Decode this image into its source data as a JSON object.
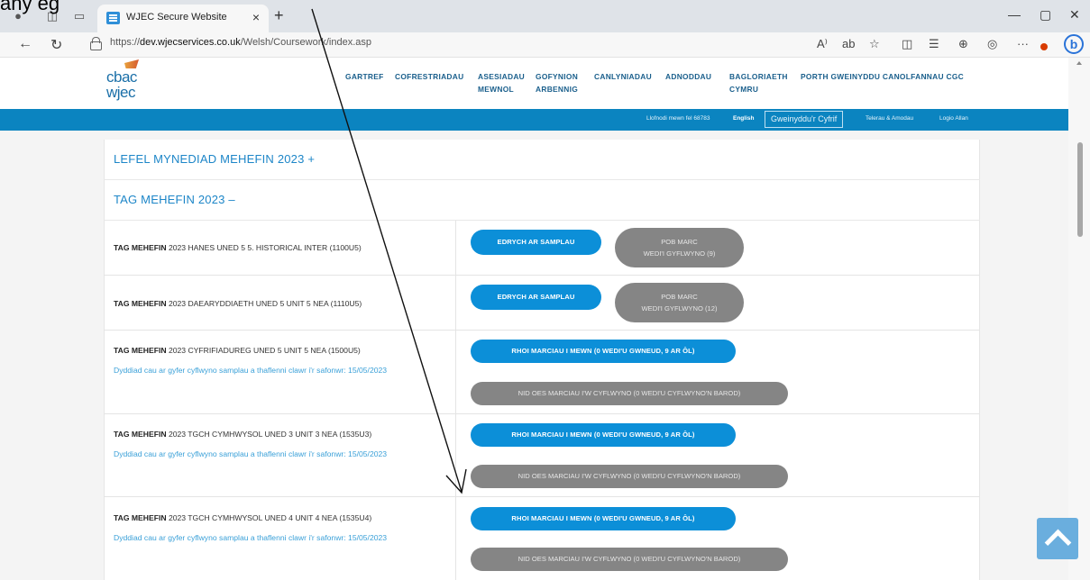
{
  "annotation_text": "any eg",
  "browser": {
    "tab_title": "WJEC Secure Website",
    "tab_close": "×",
    "new_tab": "+",
    "url_prefix": "https://",
    "url_domain": "dev.wjecservices.co.uk",
    "url_path": "/Welsh/Coursework/index.asp",
    "minimize": "—",
    "restore": "▢",
    "close": "✕",
    "bing_label": "b"
  },
  "logo": {
    "line1": "cbac",
    "line2": "wjec"
  },
  "nav": [
    {
      "label": "GARTREF"
    },
    {
      "label": "COFRESTRIADAU"
    },
    {
      "label": "ASESIADAU",
      "label2": "MEWNOL"
    },
    {
      "label": "GOFYNION",
      "label2": "ARBENNIG"
    },
    {
      "label": "CANLYNIADAU"
    },
    {
      "label": "ADNODDAU"
    },
    {
      "label": "BAGLORIAETH",
      "label2": "CYMRU"
    },
    {
      "label": "PORTH GWEINYDDU CANOLFANNAU CGC"
    }
  ],
  "topbar": {
    "logged_in": "Llofnodi mewn fel 68783",
    "english": "English",
    "admin_box": "Gweinyddu'r Cyfrif",
    "terms": "Telerau & Amodau",
    "logout": "Logio Allan"
  },
  "sections": [
    {
      "title": "LEFEL MYNEDIAD MEHEFIN 2023 +"
    },
    {
      "title": "TAG MEHEFIN 2023 –"
    }
  ],
  "rows": [
    {
      "prefix": "TAG MEHEFIN",
      "title": "2023 HANES UNED 5 5. HISTORICAL INTER (1100U5)",
      "btn1": "EDRYCH AR SAMPLAU",
      "btn2_line1": "POB MARC",
      "btn2_line2": "WEDI'I GYFLWYNO (9)"
    },
    {
      "prefix": "TAG MEHEFIN",
      "title": "2023 DAEARYDDIAETH UNED 5 UNIT 5 NEA (1110U5)",
      "btn1": "EDRYCH AR SAMPLAU",
      "btn2_line1": "POB MARC",
      "btn2_line2": "WEDI'I GYFLWYNO (12)"
    },
    {
      "prefix": "TAG MEHEFIN",
      "title": "2023 CYFRIFIADUREG UNED 5 UNIT 5 NEA (1500U5)",
      "deadline": "Dyddiad cau ar gyfer cyflwyno samplau a thaflenni clawr i'r safonwr: 15/05/2023",
      "btn1": "RHOI MARCIAU I MEWN  (0 WEDI'U GWNEUD,  9 AR ÔL)",
      "btn2": "NID OES MARCIAU I'W CYFLWYNO (0 WEDI'U CYFLWYNO'N BAROD)"
    },
    {
      "prefix": "TAG MEHEFIN",
      "title": "2023 TGCH CYMHWYSOL UNED 3 UNIT 3 NEA (1535U3)",
      "deadline": "Dyddiad cau ar gyfer cyflwyno samplau a thaflenni clawr i'r safonwr: 15/05/2023",
      "btn1": "RHOI MARCIAU I MEWN  (0 WEDI'U GWNEUD,  9 AR ÔL)",
      "btn2": "NID OES MARCIAU I'W CYFLWYNO (0 WEDI'U CYFLWYNO'N BAROD)"
    },
    {
      "prefix": "TAG MEHEFIN",
      "title": "2023 TGCH CYMHWYSOL UNED 4 UNIT 4 NEA (1535U4)",
      "deadline": "Dyddiad cau ar gyfer cyflwyno samplau a thaflenni clawr i'r safonwr: 15/05/2023",
      "btn1": "RHOI MARCIAU I MEWN  (0 WEDI'U GWNEUD,  9 AR ÔL)",
      "btn2": "NID OES MARCIAU I'W CYFLWYNO (0 WEDI'U CYFLWYNO'N BAROD)"
    }
  ],
  "colors": {
    "brand_blue": "#0b84c0",
    "button_blue": "#0c8fd8",
    "button_gray": "#858585",
    "link_blue": "#3aa0d8"
  }
}
